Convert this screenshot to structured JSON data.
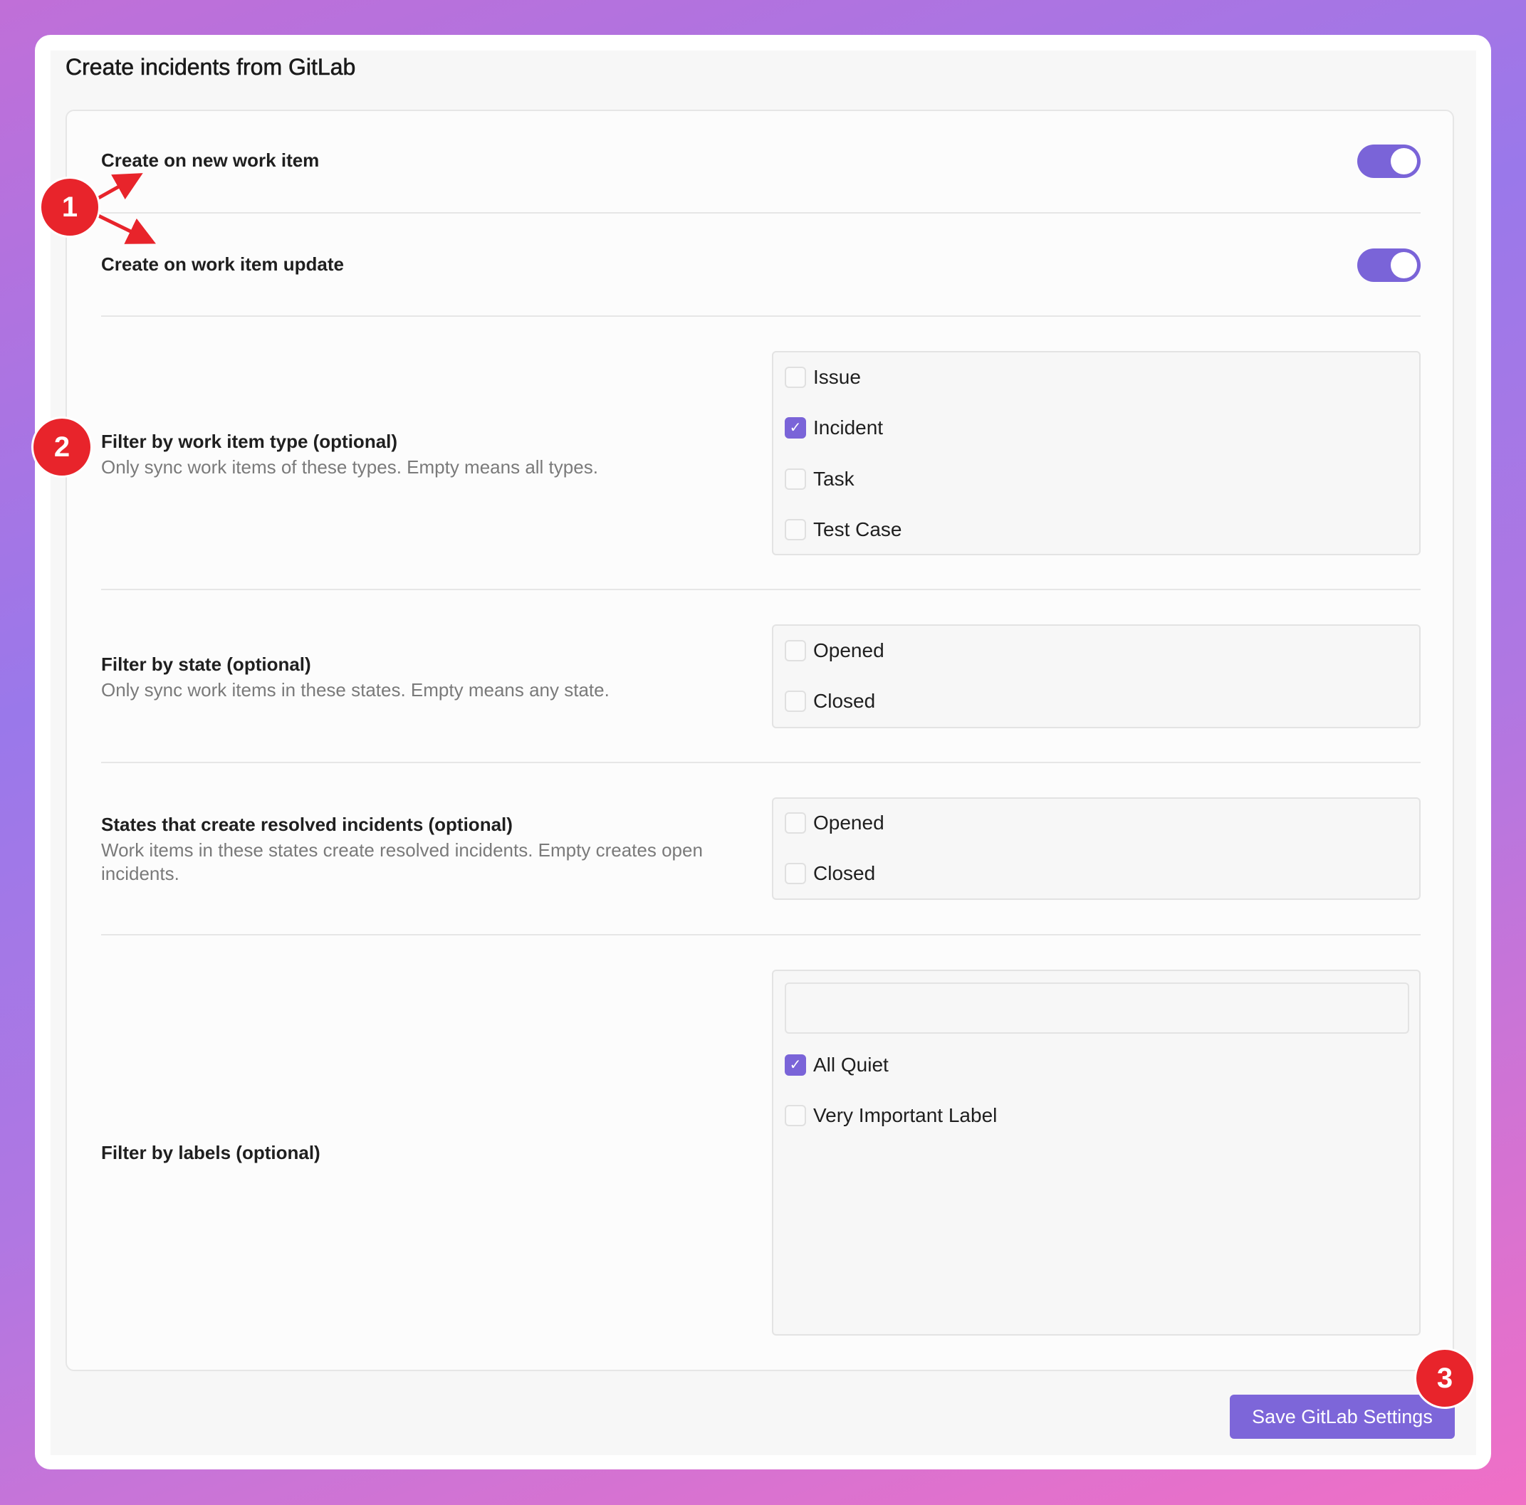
{
  "page": {
    "title": "Create incidents from GitLab"
  },
  "toggles": [
    {
      "label": "Create on new work item",
      "on": true
    },
    {
      "label": "Create on work item update",
      "on": true
    }
  ],
  "sections": {
    "type_filter": {
      "title": "Filter by work item type (optional)",
      "description": "Only sync work items of these types. Empty means all types.",
      "options": [
        {
          "label": "Issue",
          "checked": false
        },
        {
          "label": "Incident",
          "checked": true
        },
        {
          "label": "Task",
          "checked": false
        },
        {
          "label": "Test Case",
          "checked": false
        }
      ]
    },
    "state_filter": {
      "title": "Filter by state (optional)",
      "description": "Only sync work items in these states. Empty means any state.",
      "options": [
        {
          "label": "Opened",
          "checked": false
        },
        {
          "label": "Closed",
          "checked": false
        }
      ]
    },
    "resolved_states": {
      "title": "States that create resolved incidents (optional)",
      "description_line1": "Work items in these states create resolved incidents. Empty creates open",
      "description_line2": "incidents.",
      "options": [
        {
          "label": "Opened",
          "checked": false
        },
        {
          "label": "Closed",
          "checked": false
        }
      ]
    },
    "labels_filter": {
      "title": "Filter by labels (optional)",
      "search_value": "",
      "options": [
        {
          "label": "All Quiet",
          "checked": true
        },
        {
          "label": "Very Important Label",
          "checked": false
        }
      ]
    }
  },
  "save_button": {
    "label": "Save GitLab Settings"
  },
  "annotations": {
    "badge1": "1",
    "badge2": "2",
    "badge3": "3"
  },
  "colors": {
    "accent": "#7a64d8",
    "annotation_red": "#e8242b"
  }
}
